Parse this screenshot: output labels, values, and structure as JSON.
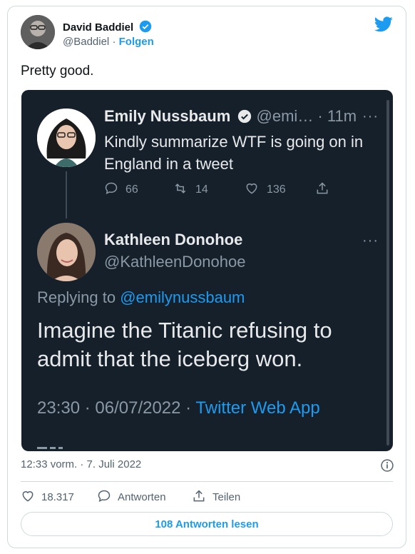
{
  "tweet": {
    "author": "David Baddiel",
    "handle": "@Baddiel",
    "separator": "·",
    "follow": "Folgen",
    "text": "Pretty good.",
    "timestamp": "12:33 vorm. · 7. Juli 2022",
    "likes": "18.317",
    "reply_label": "Antworten",
    "share_label": "Teilen",
    "read_replies": "108 Antworten lesen"
  },
  "embed": {
    "parent": {
      "name": "Emily Nussbaum",
      "meta": "@emi… · 11m",
      "text": "Kindly summarize WTF is going on in England in a tweet",
      "replies": "66",
      "retweets": "14",
      "likes": "136"
    },
    "reply": {
      "name": "Kathleen Donohoe",
      "handle": "@KathleenDonohoe",
      "replying_prefix": "Replying to",
      "replying_to": "@emilynussbaum",
      "text": "Imagine the Titanic refusing to admit that the iceberg won.",
      "time": "23:30 · 06/07/2022 ·",
      "source": "Twitter Web App"
    }
  },
  "colors": {
    "accent": "#1d9bf0",
    "embed_bg": "#15202b"
  }
}
